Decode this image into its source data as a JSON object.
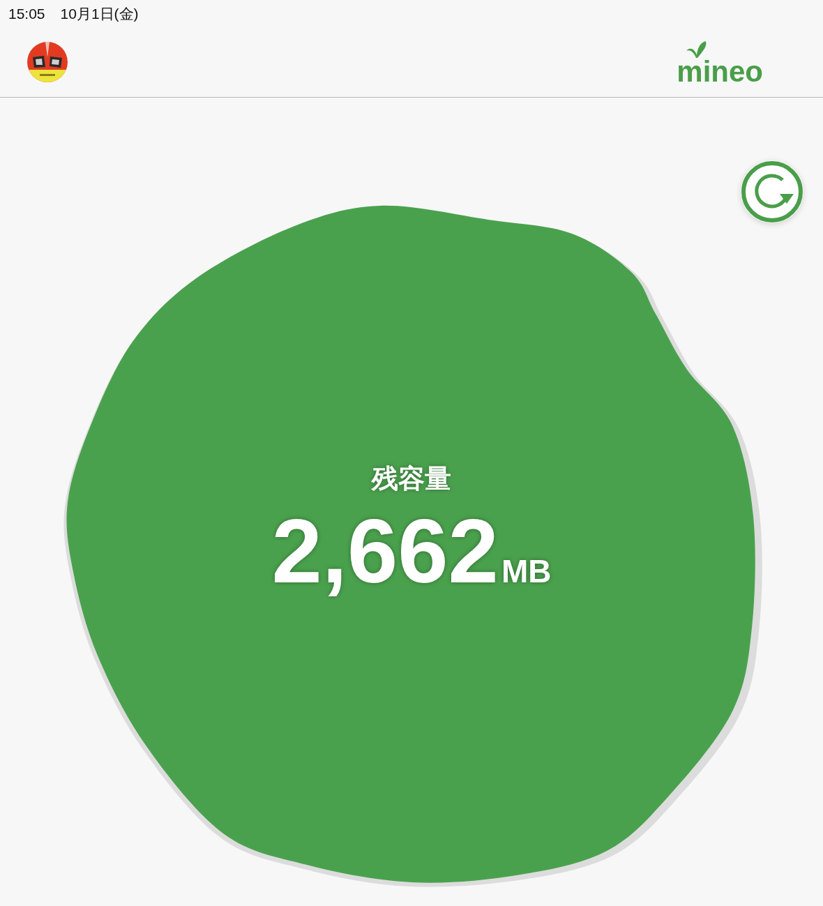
{
  "status_bar": {
    "time": "15:05",
    "date": "10月1日(金)"
  },
  "header": {
    "logo": "mineo"
  },
  "remaining": {
    "label": "残容量",
    "amount": "2,662",
    "unit": "MB"
  }
}
